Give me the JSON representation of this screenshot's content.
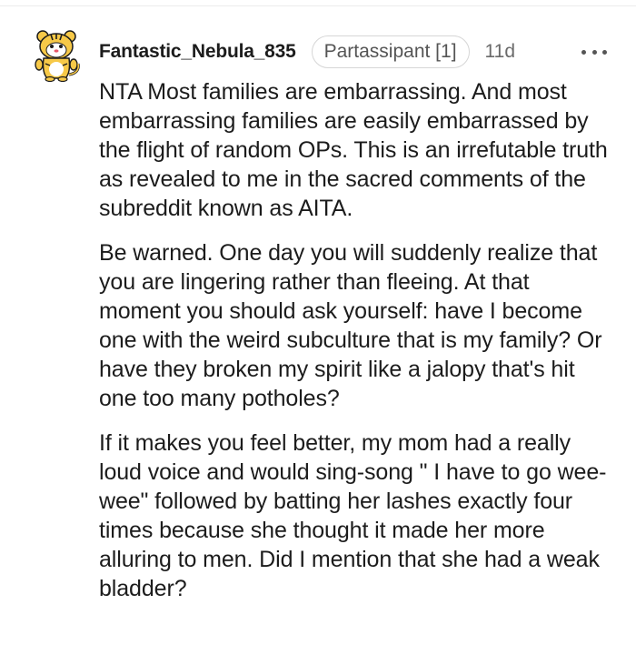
{
  "comment": {
    "author": "Fantastic_Nebula_835",
    "flair": "Partassipant [1]",
    "timestamp": "11d",
    "more_icon": "more-horizontal-icon",
    "avatar_icon": "tiger-snoo-avatar-icon",
    "paragraphs": [
      "NTA Most families are embarrassing. And most embarrassing families are easily embarrassed by the flight of random OPs. This is an irrefutable truth as revealed to me in the sacred comments of the subreddit known as AITA.",
      "Be warned. One day you will suddenly realize that you are lingering rather than fleeing. At that moment you should ask yourself: have I become one with the weird subculture that is my family? Or have they broken my spirit like a jalopy that's hit one too many potholes?",
      "If it makes you feel better, my mom had a really loud voice and would sing-song \" I have to go wee-wee\" followed by batting her lashes exactly four times because she thought it made her more alluring to men. Did I mention that she had a weak bladder?"
    ]
  },
  "colors": {
    "text": "#1c1c1c",
    "muted": "#6a6a6a",
    "flair_border": "#d6d6d6",
    "avatar_yellow": "#f7c948"
  }
}
